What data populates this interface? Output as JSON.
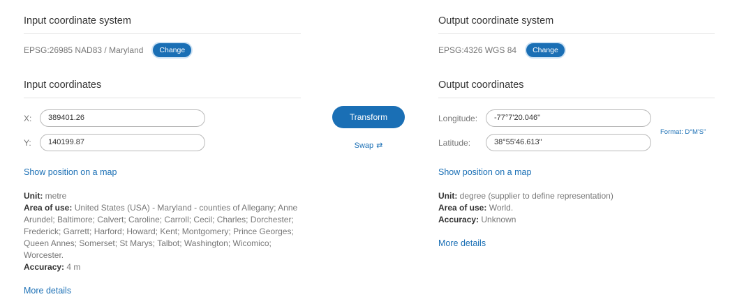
{
  "input": {
    "title": "Input coordinate system",
    "crs": "EPSG:26985 NAD83 / Maryland",
    "change_label": "Change",
    "coords_title": "Input coordinates",
    "x_label": "X:",
    "x_value": "389401.26",
    "y_label": "Y:",
    "y_value": "140199.87",
    "show_map": "Show position on a map",
    "unit_label": "Unit:",
    "unit_value": "metre",
    "area_label": "Area of use:",
    "area_value": "United States (USA) - Maryland - counties of Allegany; Anne Arundel; Baltimore; Calvert; Caroline; Carroll; Cecil; Charles; Dorchester; Frederick; Garrett; Harford; Howard; Kent; Montgomery; Prince Georges; Queen Annes; Somerset; St Marys; Talbot; Washington; Wicomico; Worcester.",
    "accuracy_label": "Accuracy:",
    "accuracy_value": "4 m",
    "more_details": "More details"
  },
  "actions": {
    "transform_label": "Transform",
    "swap_label": "Swap",
    "swap_icon": "swap-arrows-icon"
  },
  "output": {
    "title": "Output coordinate system",
    "crs": "EPSG:4326 WGS 84",
    "change_label": "Change",
    "coords_title": "Output coordinates",
    "lon_label": "Longitude:",
    "lon_value": "-77°7'20.046\"",
    "lat_label": "Latitude:",
    "lat_value": "38°55'46.613\"",
    "format_label": "Format: D°M'S\"",
    "show_map": "Show position on a map",
    "unit_label": "Unit:",
    "unit_value": "degree (supplier to define representation)",
    "area_label": "Area of use:",
    "area_value": "World.",
    "accuracy_label": "Accuracy:",
    "accuracy_value": "Unknown",
    "more_details": "More details"
  },
  "colors": {
    "accent": "#1a6fb5",
    "muted_text": "#777777",
    "text": "#333333"
  }
}
